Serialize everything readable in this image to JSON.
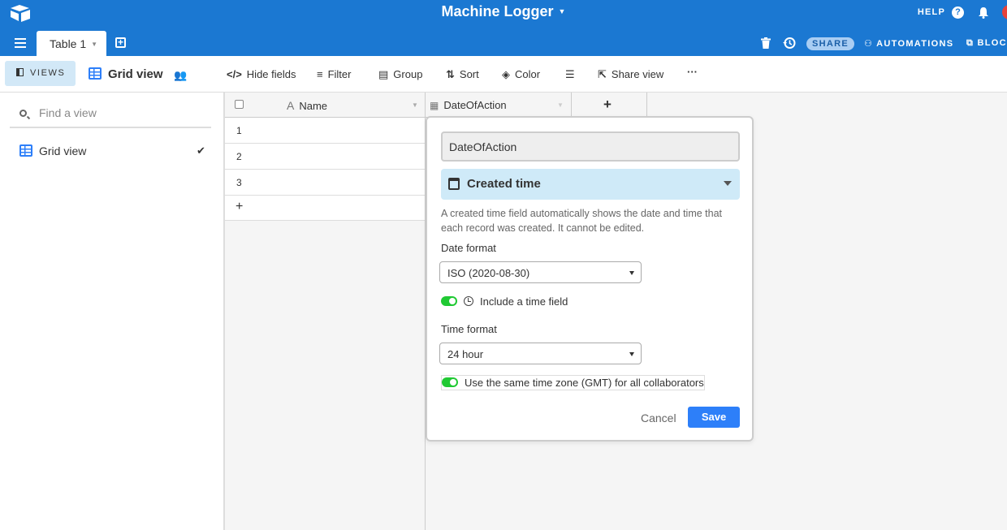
{
  "app": {
    "base_title": "Machine Logger",
    "help_label": "HELP",
    "table_tab": "Table 1",
    "share_label": "SHARE",
    "automations_label": "AUTOMATIONS",
    "blocks_label": "BLOC"
  },
  "toolbar": {
    "views_label": "VIEWS",
    "current_view": "Grid view",
    "hide_fields": "Hide fields",
    "filter": "Filter",
    "group": "Group",
    "sort": "Sort",
    "color": "Color",
    "share_view": "Share view",
    "more": "···"
  },
  "sidebar": {
    "search_placeholder": "Find a view",
    "views": [
      {
        "label": "Grid view",
        "selected": true
      }
    ]
  },
  "grid": {
    "columns": [
      "Name",
      "DateOfAction"
    ],
    "add_column": "+",
    "rows": [
      "1",
      "2",
      "3"
    ],
    "add_row": "+"
  },
  "field_editor": {
    "field_name": "DateOfAction",
    "field_type": "Created time",
    "description": "A created time field automatically shows the date and time that each record was created. It cannot be edited.",
    "date_format_label": "Date format",
    "date_format_value": "ISO (2020-08-30)",
    "include_time_label": "Include a time field",
    "include_time_on": true,
    "time_format_label": "Time format",
    "time_format_value": "24 hour",
    "same_tz_label": "Use the same time zone (GMT) for all collaborators",
    "same_tz_on": true,
    "cancel_label": "Cancel",
    "save_label": "Save"
  },
  "colors": {
    "header_blue": "#1b78d2",
    "accent_blue": "#2d7ff9",
    "toggle_green": "#20c933",
    "type_select_bg": "#cfeaf8"
  }
}
